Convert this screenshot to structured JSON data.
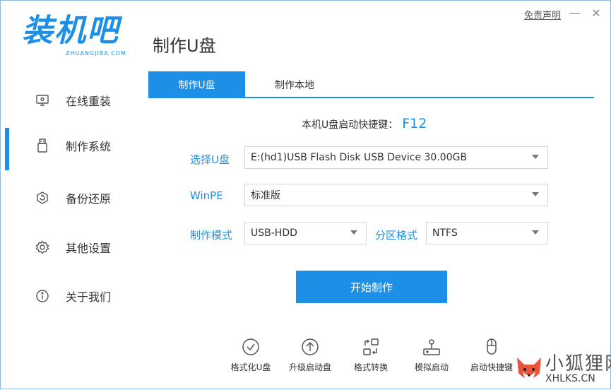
{
  "app": {
    "logo_text": "装机吧",
    "logo_sub": "ZHUANGJIBA.COM",
    "disclaimer_link": "免责声明",
    "minimize_glyph": "—",
    "close_glyph": "✕",
    "page_title": "制作U盘"
  },
  "sidebar": {
    "items": [
      {
        "label": "在线重装",
        "icon": "monitor-icon"
      },
      {
        "label": "制作系统",
        "icon": "usb-drive-icon",
        "active": true
      },
      {
        "label": "备份还原",
        "icon": "backup-icon"
      },
      {
        "label": "其他设置",
        "icon": "gear-icon"
      },
      {
        "label": "关于我们",
        "icon": "info-icon"
      }
    ]
  },
  "tabs": [
    {
      "label": "制作U盘",
      "active": true
    },
    {
      "label": "制作本地",
      "active": false
    }
  ],
  "hotkey": {
    "label": "本机U盘启动快捷键：",
    "key": "F12"
  },
  "form": {
    "usb_label": "选择U盘",
    "usb_value": "E:(hd1)USB Flash Disk USB Device 30.00GB",
    "winpe_label": "WinPE",
    "winpe_value": "标准版",
    "mode_label": "制作模式",
    "mode_value": "USB-HDD",
    "partition_label": "分区格式",
    "partition_value": "NTFS"
  },
  "start_button": "开始制作",
  "tools": [
    {
      "label": "格式化U盘",
      "icon": "check-circle-icon"
    },
    {
      "label": "升级启动盘",
      "icon": "upgrade-arrow-icon"
    },
    {
      "label": "格式转换",
      "icon": "convert-icon"
    },
    {
      "label": "模拟启动",
      "icon": "simulate-icon"
    },
    {
      "label": "启动快捷键",
      "icon": "mouse-icon"
    }
  ],
  "watermark": {
    "cn": "小狐狸网",
    "en": "XHLKS.CN"
  },
  "colors": {
    "accent": "#1e8fe6"
  }
}
